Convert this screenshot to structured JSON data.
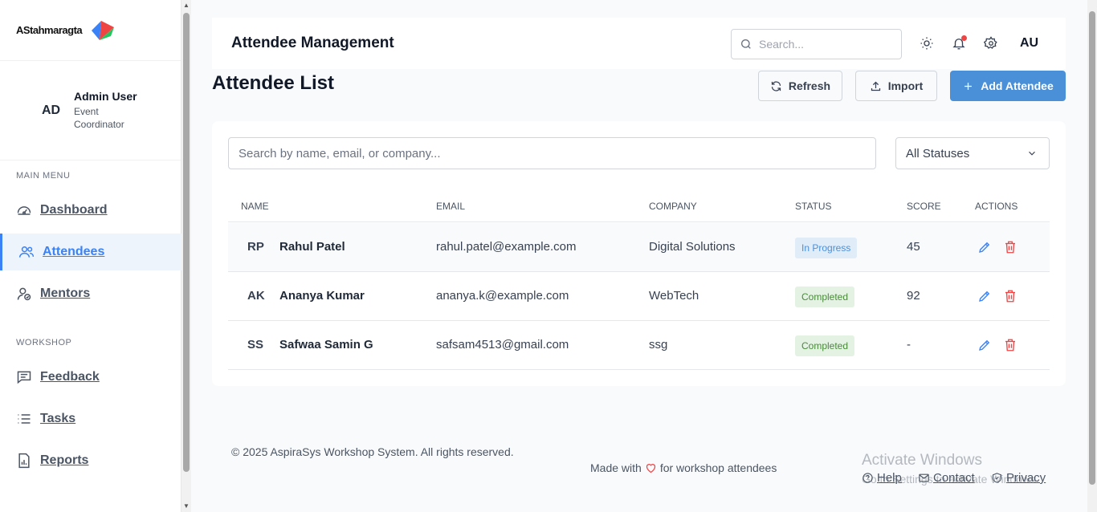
{
  "sidebar": {
    "logo_text": "AStahmaragta",
    "profile": {
      "initials": "AD",
      "name": "Admin User",
      "role": "Event Coordinator"
    },
    "sections": {
      "main": "MAIN MENU",
      "workshop": "WORKSHOP"
    },
    "main_items": [
      {
        "label": "Dashboard",
        "icon": "gauge-icon"
      },
      {
        "label": "Attendees",
        "icon": "users-icon"
      },
      {
        "label": "Mentors",
        "icon": "user-check-icon"
      }
    ],
    "workshop_items": [
      {
        "label": "Feedback",
        "icon": "message-square-icon"
      },
      {
        "label": "Tasks",
        "icon": "list-icon"
      },
      {
        "label": "Reports",
        "icon": "file-chart-icon"
      }
    ]
  },
  "header": {
    "title": "Attendee Management",
    "search_placeholder": "Search...",
    "avatar": "AU"
  },
  "page": {
    "title": "Attendee List",
    "refresh_label": "Refresh",
    "import_label": "Import",
    "add_label": "Add Attendee"
  },
  "filters": {
    "search_placeholder": "Search by name, email, or company...",
    "status_value": "All Statuses"
  },
  "table": {
    "headers": {
      "name": "NAME",
      "email": "EMAIL",
      "company": "COMPANY",
      "status": "STATUS",
      "score": "SCORE",
      "actions": "ACTIONS"
    },
    "rows": [
      {
        "initials": "RP",
        "name": "Rahul Patel",
        "email": "rahul.patel@example.com",
        "company": "Digital Solutions",
        "status": "In Progress",
        "score": "45"
      },
      {
        "initials": "AK",
        "name": "Ananya Kumar",
        "email": "ananya.k@example.com",
        "company": "WebTech",
        "status": "Completed",
        "score": "92"
      },
      {
        "initials": "SS",
        "name": "Safwaa Samin G",
        "email": "safsam4513@gmail.com",
        "company": "ssg",
        "status": "Completed",
        "score": "-"
      }
    ]
  },
  "footer": {
    "copyright": "© 2025 AspiraSys Workshop System. All rights reserved.",
    "made_with_prefix": "Made with",
    "made_with_suffix": "for workshop attendees",
    "help": "Help",
    "contact": "Contact",
    "privacy": "Privacy"
  },
  "watermark": {
    "title": "Activate Windows",
    "subtitle": "Go to Settings to activate Windows."
  },
  "colors": {
    "accent": "#4a90d9",
    "danger": "#ef4444",
    "badge_progress_bg": "#e0ecf8",
    "badge_completed_bg": "#e3f2e3"
  }
}
